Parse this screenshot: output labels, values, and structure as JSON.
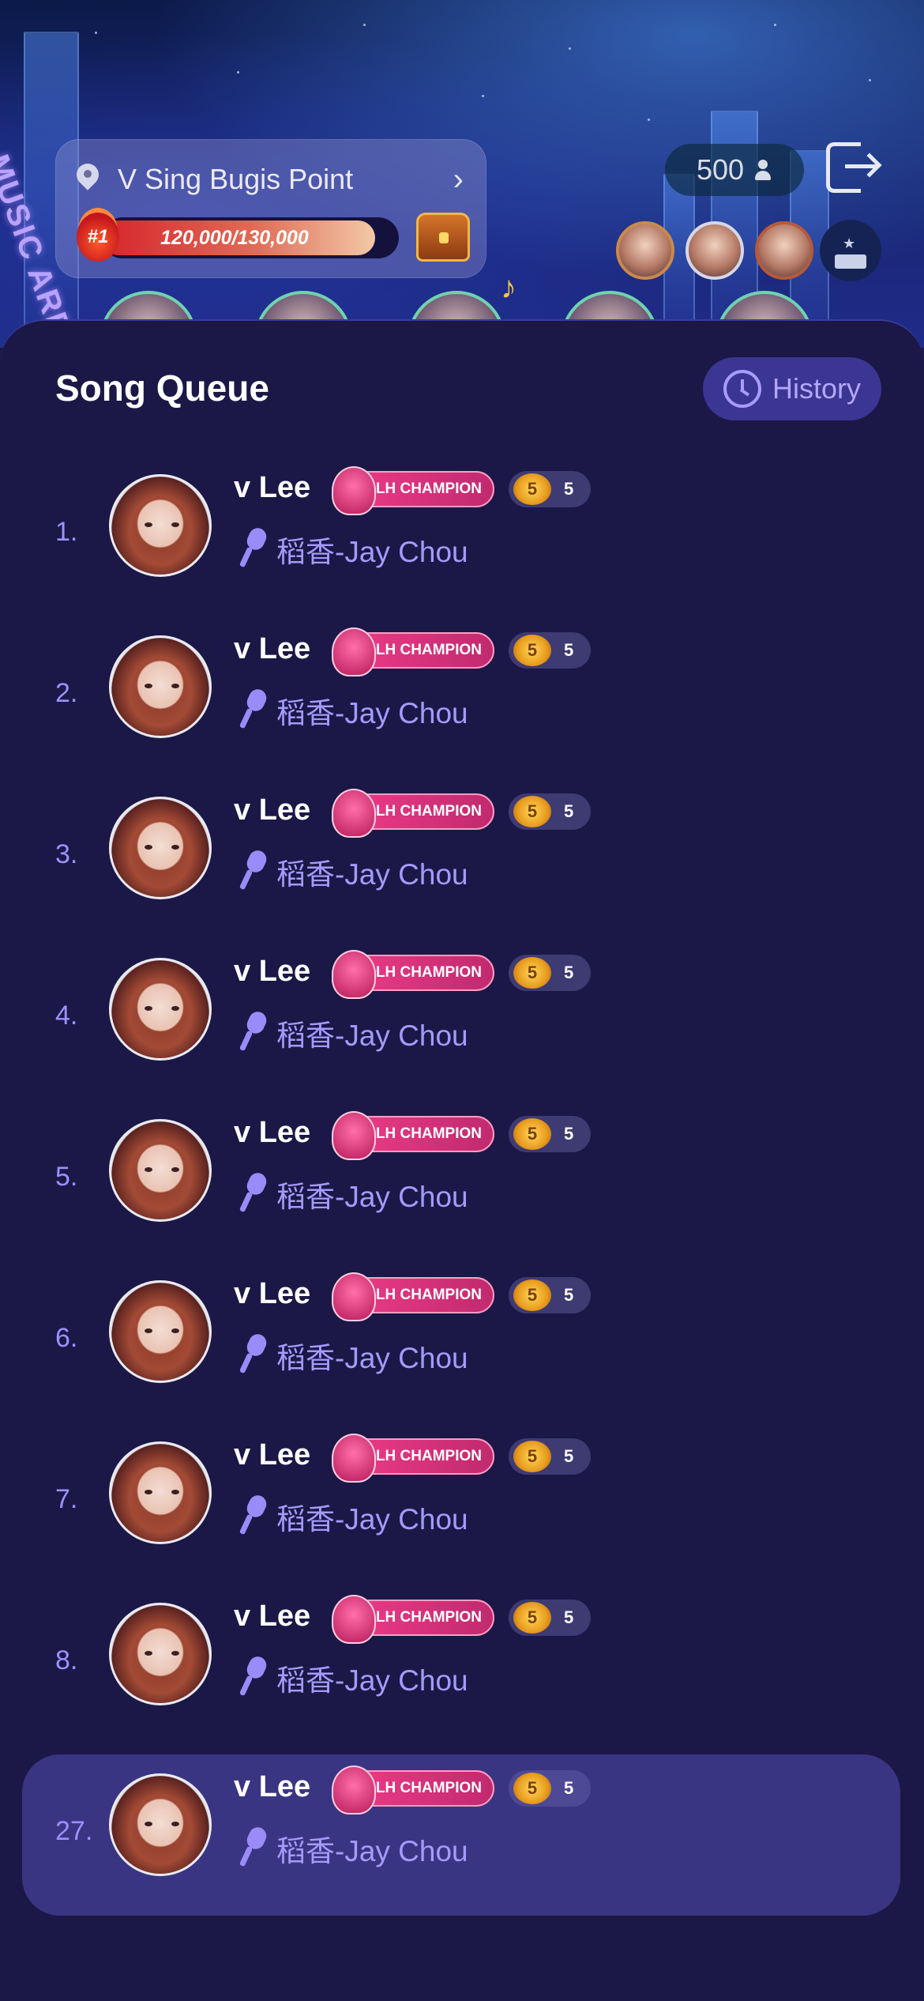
{
  "header": {
    "location_name": "V Sing Bugis Point",
    "rank_badge": "#1",
    "progress_text": "120,000/130,000",
    "progress_fraction": 0.923,
    "audience_count": "500",
    "arena_text": "MUSIC ARENA"
  },
  "queue": {
    "title": "Song Queue",
    "history_label": "History",
    "items": [
      {
        "index": "1.",
        "name": "v Lee",
        "badge": "LH CHAMPION",
        "level": "5",
        "song": "稻香-Jay Chou"
      },
      {
        "index": "2.",
        "name": "v Lee",
        "badge": "LH CHAMPION",
        "level": "5",
        "song": "稻香-Jay Chou"
      },
      {
        "index": "3.",
        "name": "v Lee",
        "badge": "LH CHAMPION",
        "level": "5",
        "song": "稻香-Jay Chou"
      },
      {
        "index": "4.",
        "name": "v Lee",
        "badge": "LH CHAMPION",
        "level": "5",
        "song": "稻香-Jay Chou"
      },
      {
        "index": "5.",
        "name": "v Lee",
        "badge": "LH CHAMPION",
        "level": "5",
        "song": "稻香-Jay Chou"
      },
      {
        "index": "6.",
        "name": "v Lee",
        "badge": "LH CHAMPION",
        "level": "5",
        "song": "稻香-Jay Chou"
      },
      {
        "index": "7.",
        "name": "v Lee",
        "badge": "LH CHAMPION",
        "level": "5",
        "song": "稻香-Jay Chou"
      },
      {
        "index": "8.",
        "name": "v Lee",
        "badge": "LH CHAMPION",
        "level": "5",
        "song": "稻香-Jay Chou"
      }
    ],
    "current": {
      "index": "27.",
      "name": "v Lee",
      "badge": "LH CHAMPION",
      "level": "5",
      "song": "稻香-Jay Chou"
    }
  }
}
